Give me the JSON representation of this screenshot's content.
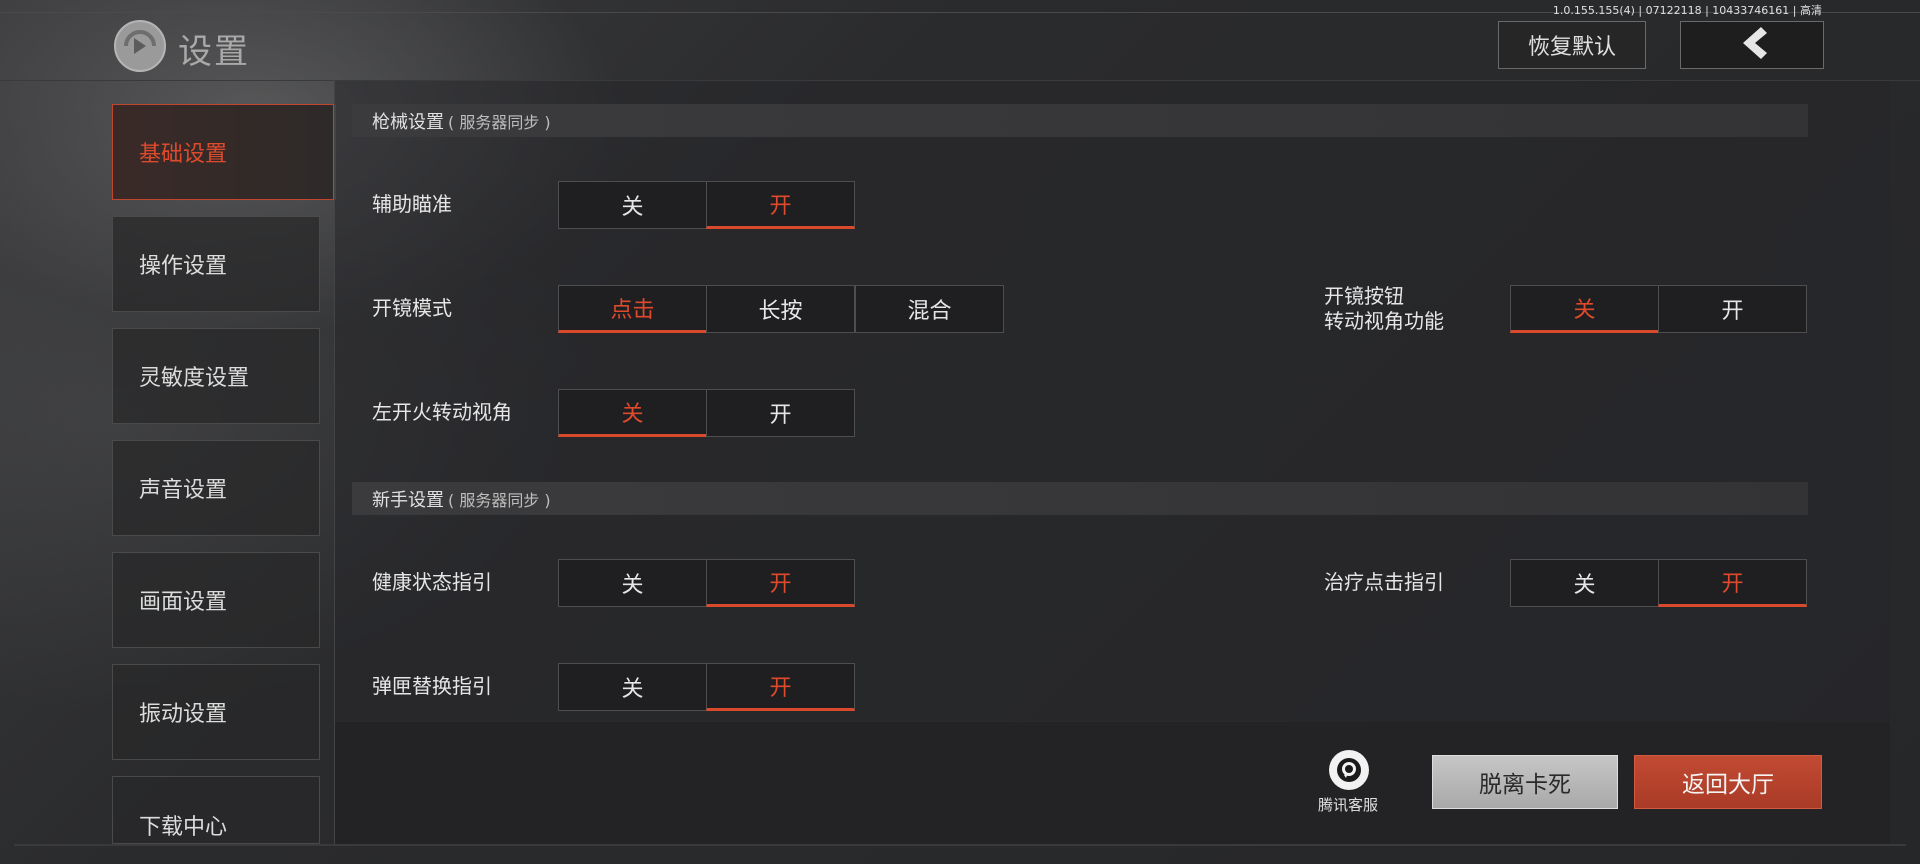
{
  "header": {
    "title": "设置",
    "version": "1.0.155.155(4) | 07122118 | 10433746161 | 高清",
    "restore_label": "恢复默认",
    "back_icon": "chevron-left-icon"
  },
  "sidebar": {
    "items": [
      {
        "label": "基础设置",
        "active": true
      },
      {
        "label": "操作设置",
        "active": false
      },
      {
        "label": "灵敏度设置",
        "active": false
      },
      {
        "label": "声音设置",
        "active": false
      },
      {
        "label": "画面设置",
        "active": false
      },
      {
        "label": "振动设置",
        "active": false
      },
      {
        "label": "下载中心",
        "active": false
      }
    ]
  },
  "sections": {
    "firearm": {
      "title": "枪械设置",
      "note": "( 服务器同步 )"
    },
    "newbie": {
      "title": "新手设置",
      "note": "( 服务器同步 )"
    }
  },
  "settings": {
    "aim_assist": {
      "label": "辅助瞄准",
      "options": [
        "关",
        "开"
      ],
      "selected": "开"
    },
    "scope_mode": {
      "label": "开镜模式",
      "options": [
        "点击",
        "长按",
        "混合"
      ],
      "selected": "点击"
    },
    "scope_button_rotate": {
      "label_line1": "开镜按钮",
      "label_line2": "转动视角功能",
      "options": [
        "关",
        "开"
      ],
      "selected": "关"
    },
    "left_fire_rotate": {
      "label": "左开火转动视角",
      "options": [
        "关",
        "开"
      ],
      "selected": "关"
    },
    "health_guide": {
      "label": "健康状态指引",
      "options": [
        "关",
        "开"
      ],
      "selected": "开"
    },
    "heal_click_guide": {
      "label": "治疗点击指引",
      "options": [
        "关",
        "开"
      ],
      "selected": "开"
    },
    "mag_swap_guide": {
      "label": "弹匣替换指引",
      "options": [
        "关",
        "开"
      ],
      "selected": "开"
    }
  },
  "footer": {
    "support_label": "腾讯客服",
    "support_icon": "customer-service-icon",
    "unstuck_label": "脱离卡死",
    "lobby_label": "返回大厅"
  },
  "colors": {
    "accent": "#e04a2c",
    "lobby_button": "#b4412c",
    "unstuck_button": "#b8b8b8"
  }
}
